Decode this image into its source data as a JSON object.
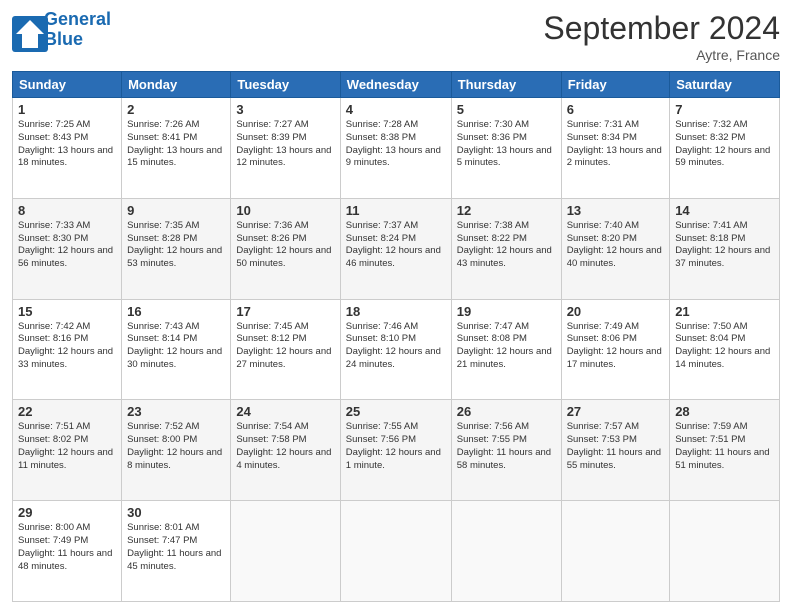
{
  "header": {
    "logo_line1": "General",
    "logo_line2": "Blue",
    "month_title": "September 2024",
    "location": "Aytre, France"
  },
  "days_of_week": [
    "Sunday",
    "Monday",
    "Tuesday",
    "Wednesday",
    "Thursday",
    "Friday",
    "Saturday"
  ],
  "weeks": [
    [
      {
        "day": "1",
        "sunrise": "Sunrise: 7:25 AM",
        "sunset": "Sunset: 8:43 PM",
        "daylight": "Daylight: 13 hours and 18 minutes."
      },
      {
        "day": "2",
        "sunrise": "Sunrise: 7:26 AM",
        "sunset": "Sunset: 8:41 PM",
        "daylight": "Daylight: 13 hours and 15 minutes."
      },
      {
        "day": "3",
        "sunrise": "Sunrise: 7:27 AM",
        "sunset": "Sunset: 8:39 PM",
        "daylight": "Daylight: 13 hours and 12 minutes."
      },
      {
        "day": "4",
        "sunrise": "Sunrise: 7:28 AM",
        "sunset": "Sunset: 8:38 PM",
        "daylight": "Daylight: 13 hours and 9 minutes."
      },
      {
        "day": "5",
        "sunrise": "Sunrise: 7:30 AM",
        "sunset": "Sunset: 8:36 PM",
        "daylight": "Daylight: 13 hours and 5 minutes."
      },
      {
        "day": "6",
        "sunrise": "Sunrise: 7:31 AM",
        "sunset": "Sunset: 8:34 PM",
        "daylight": "Daylight: 13 hours and 2 minutes."
      },
      {
        "day": "7",
        "sunrise": "Sunrise: 7:32 AM",
        "sunset": "Sunset: 8:32 PM",
        "daylight": "Daylight: 12 hours and 59 minutes."
      }
    ],
    [
      {
        "day": "8",
        "sunrise": "Sunrise: 7:33 AM",
        "sunset": "Sunset: 8:30 PM",
        "daylight": "Daylight: 12 hours and 56 minutes."
      },
      {
        "day": "9",
        "sunrise": "Sunrise: 7:35 AM",
        "sunset": "Sunset: 8:28 PM",
        "daylight": "Daylight: 12 hours and 53 minutes."
      },
      {
        "day": "10",
        "sunrise": "Sunrise: 7:36 AM",
        "sunset": "Sunset: 8:26 PM",
        "daylight": "Daylight: 12 hours and 50 minutes."
      },
      {
        "day": "11",
        "sunrise": "Sunrise: 7:37 AM",
        "sunset": "Sunset: 8:24 PM",
        "daylight": "Daylight: 12 hours and 46 minutes."
      },
      {
        "day": "12",
        "sunrise": "Sunrise: 7:38 AM",
        "sunset": "Sunset: 8:22 PM",
        "daylight": "Daylight: 12 hours and 43 minutes."
      },
      {
        "day": "13",
        "sunrise": "Sunrise: 7:40 AM",
        "sunset": "Sunset: 8:20 PM",
        "daylight": "Daylight: 12 hours and 40 minutes."
      },
      {
        "day": "14",
        "sunrise": "Sunrise: 7:41 AM",
        "sunset": "Sunset: 8:18 PM",
        "daylight": "Daylight: 12 hours and 37 minutes."
      }
    ],
    [
      {
        "day": "15",
        "sunrise": "Sunrise: 7:42 AM",
        "sunset": "Sunset: 8:16 PM",
        "daylight": "Daylight: 12 hours and 33 minutes."
      },
      {
        "day": "16",
        "sunrise": "Sunrise: 7:43 AM",
        "sunset": "Sunset: 8:14 PM",
        "daylight": "Daylight: 12 hours and 30 minutes."
      },
      {
        "day": "17",
        "sunrise": "Sunrise: 7:45 AM",
        "sunset": "Sunset: 8:12 PM",
        "daylight": "Daylight: 12 hours and 27 minutes."
      },
      {
        "day": "18",
        "sunrise": "Sunrise: 7:46 AM",
        "sunset": "Sunset: 8:10 PM",
        "daylight": "Daylight: 12 hours and 24 minutes."
      },
      {
        "day": "19",
        "sunrise": "Sunrise: 7:47 AM",
        "sunset": "Sunset: 8:08 PM",
        "daylight": "Daylight: 12 hours and 21 minutes."
      },
      {
        "day": "20",
        "sunrise": "Sunrise: 7:49 AM",
        "sunset": "Sunset: 8:06 PM",
        "daylight": "Daylight: 12 hours and 17 minutes."
      },
      {
        "day": "21",
        "sunrise": "Sunrise: 7:50 AM",
        "sunset": "Sunset: 8:04 PM",
        "daylight": "Daylight: 12 hours and 14 minutes."
      }
    ],
    [
      {
        "day": "22",
        "sunrise": "Sunrise: 7:51 AM",
        "sunset": "Sunset: 8:02 PM",
        "daylight": "Daylight: 12 hours and 11 minutes."
      },
      {
        "day": "23",
        "sunrise": "Sunrise: 7:52 AM",
        "sunset": "Sunset: 8:00 PM",
        "daylight": "Daylight: 12 hours and 8 minutes."
      },
      {
        "day": "24",
        "sunrise": "Sunrise: 7:54 AM",
        "sunset": "Sunset: 7:58 PM",
        "daylight": "Daylight: 12 hours and 4 minutes."
      },
      {
        "day": "25",
        "sunrise": "Sunrise: 7:55 AM",
        "sunset": "Sunset: 7:56 PM",
        "daylight": "Daylight: 12 hours and 1 minute."
      },
      {
        "day": "26",
        "sunrise": "Sunrise: 7:56 AM",
        "sunset": "Sunset: 7:55 PM",
        "daylight": "Daylight: 11 hours and 58 minutes."
      },
      {
        "day": "27",
        "sunrise": "Sunrise: 7:57 AM",
        "sunset": "Sunset: 7:53 PM",
        "daylight": "Daylight: 11 hours and 55 minutes."
      },
      {
        "day": "28",
        "sunrise": "Sunrise: 7:59 AM",
        "sunset": "Sunset: 7:51 PM",
        "daylight": "Daylight: 11 hours and 51 minutes."
      }
    ],
    [
      {
        "day": "29",
        "sunrise": "Sunrise: 8:00 AM",
        "sunset": "Sunset: 7:49 PM",
        "daylight": "Daylight: 11 hours and 48 minutes."
      },
      {
        "day": "30",
        "sunrise": "Sunrise: 8:01 AM",
        "sunset": "Sunset: 7:47 PM",
        "daylight": "Daylight: 11 hours and 45 minutes."
      },
      null,
      null,
      null,
      null,
      null
    ]
  ]
}
